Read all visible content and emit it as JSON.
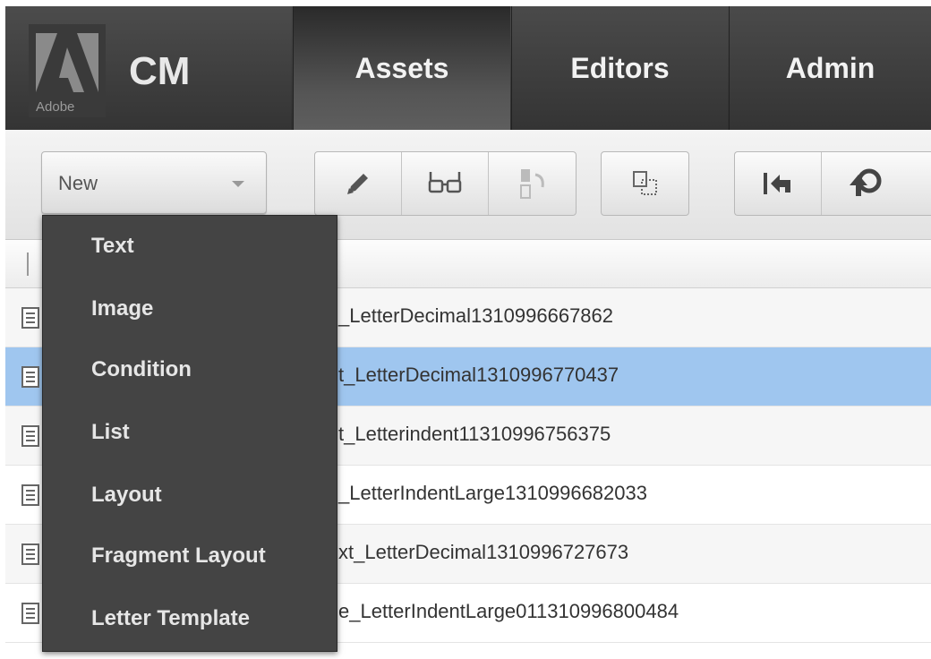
{
  "brand": {
    "logo_text": "Adobe",
    "app_name": "CM"
  },
  "nav": {
    "assets": "Assets",
    "editors": "Editors",
    "admin": "Admin"
  },
  "toolbar": {
    "new_select": {
      "value": "New"
    },
    "buttons": [
      "pencil-icon",
      "glasses-icon",
      "move-icon",
      "copy-icon",
      "undo-icon",
      "publish-icon"
    ]
  },
  "menu": {
    "items": [
      "Text",
      "Image",
      "Condition",
      "List",
      "Layout",
      "Fragment Layout",
      "Letter Template"
    ]
  },
  "list": {
    "rows": [
      {
        "name": "_LetterDecimal1310996667862",
        "selected": false
      },
      {
        "name": "t_LetterDecimal1310996770437",
        "selected": true
      },
      {
        "name": "t_Letterindent11310996756375",
        "selected": false
      },
      {
        "name": "_LetterIndentLarge1310996682033",
        "selected": false
      },
      {
        "name": "xt_LetterDecimal1310996727673",
        "selected": false
      },
      {
        "name": "e_LetterIndentLarge011310996800484",
        "selected": false
      }
    ]
  },
  "colors": {
    "topbar": "#343434",
    "selected_row": "#9fc6ef",
    "menu_bg": "#444444"
  }
}
